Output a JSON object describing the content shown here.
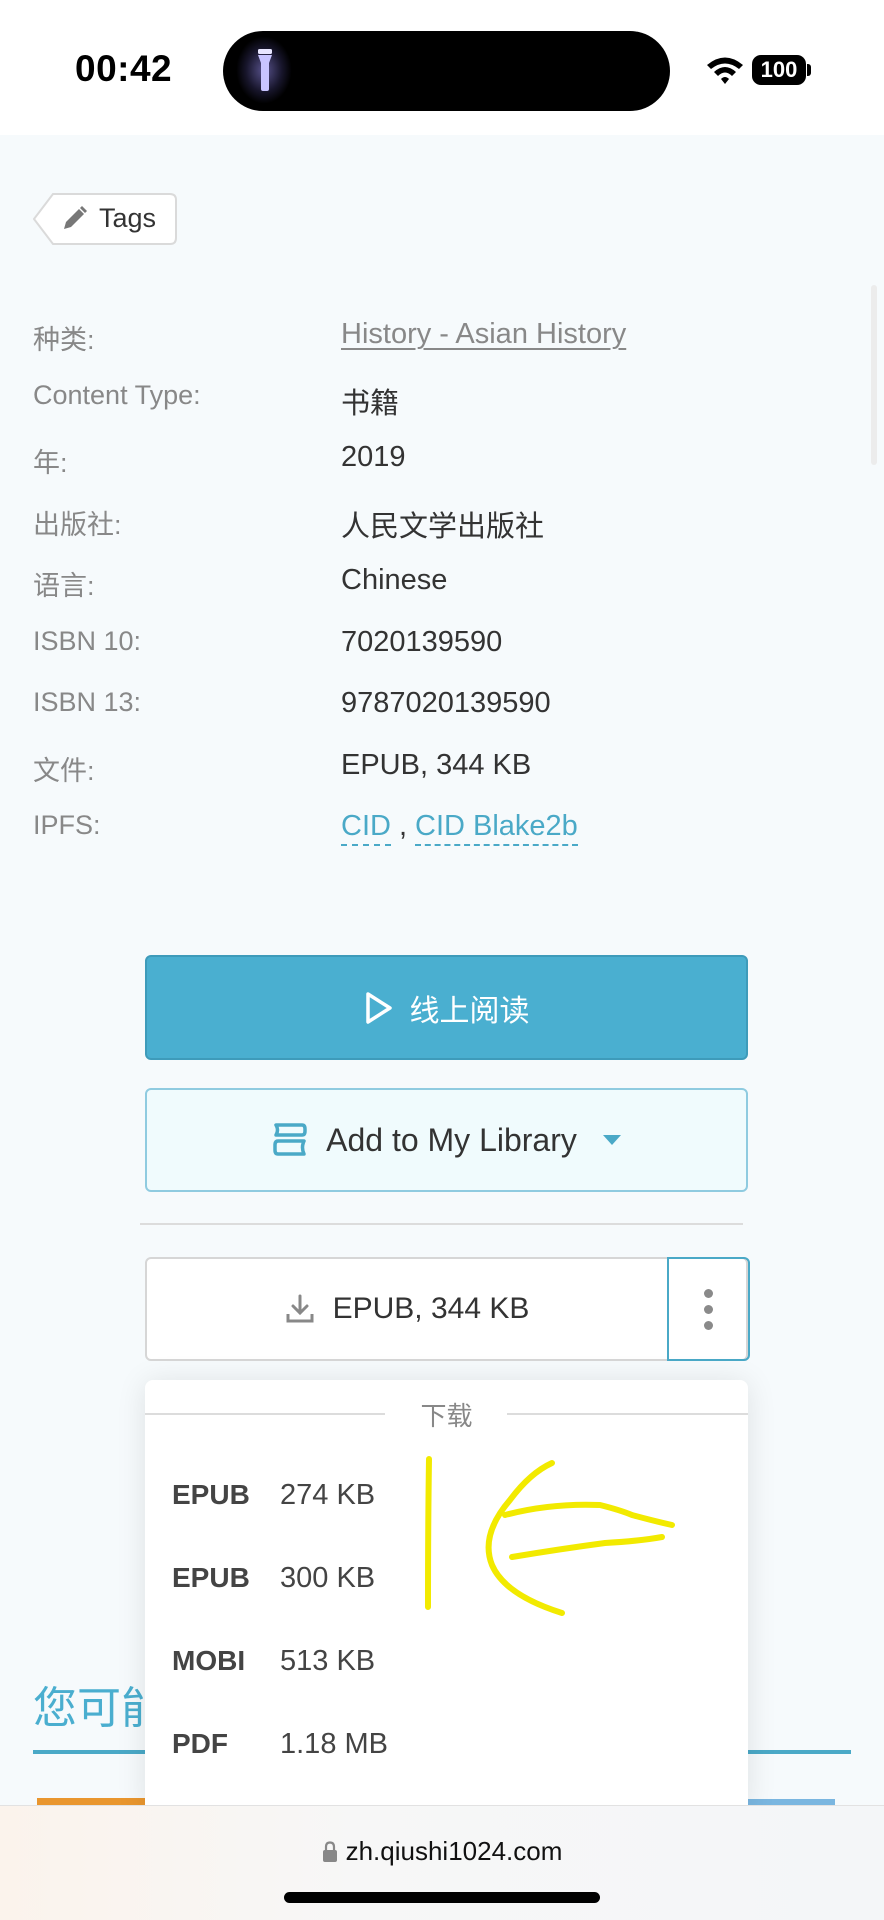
{
  "status_bar": {
    "time": "00:42",
    "battery": "100",
    "icons": [
      "flashlight-icon",
      "wifi-icon",
      "battery-icon"
    ]
  },
  "tags_button": {
    "label": "Tags",
    "icon": "pencil-icon"
  },
  "details": [
    {
      "key": "种类:",
      "value": "History - Asian History",
      "type": "link"
    },
    {
      "key": "Content Type:",
      "value": "书籍"
    },
    {
      "key": "年:",
      "value": "2019"
    },
    {
      "key": "出版社:",
      "value": "人民文学出版社"
    },
    {
      "key": "语言:",
      "value": "Chinese"
    },
    {
      "key": "ISBN 10:",
      "value": "7020139590"
    },
    {
      "key": "ISBN 13:",
      "value": "9787020139590"
    },
    {
      "key": "文件:",
      "value": "EPUB, 344 KB"
    },
    {
      "key": "IPFS:",
      "links": [
        "CID",
        "CID Blake2b"
      ],
      "separator": ","
    }
  ],
  "actions": {
    "read_online": {
      "label": "线上阅读",
      "icon": "play-icon"
    },
    "add_library": {
      "label": "Add to My Library",
      "icon": "books-icon"
    },
    "download": {
      "label": "EPUB, 344 KB",
      "icon": "download-icon"
    },
    "more": {
      "icon": "more-vertical-icon"
    }
  },
  "dropdown": {
    "header": "下载",
    "items": [
      {
        "format": "EPUB",
        "size": "274 KB"
      },
      {
        "format": "EPUB",
        "size": "300 KB"
      },
      {
        "format": "MOBI",
        "size": "513 KB"
      },
      {
        "format": "PDF",
        "size": "1.18 MB"
      }
    ]
  },
  "section": {
    "title": "您可能"
  },
  "colors": {
    "accent": "#4aafd0",
    "annotation": "#f2ea00"
  },
  "browser": {
    "url": "zh.qiushi1024.com"
  }
}
